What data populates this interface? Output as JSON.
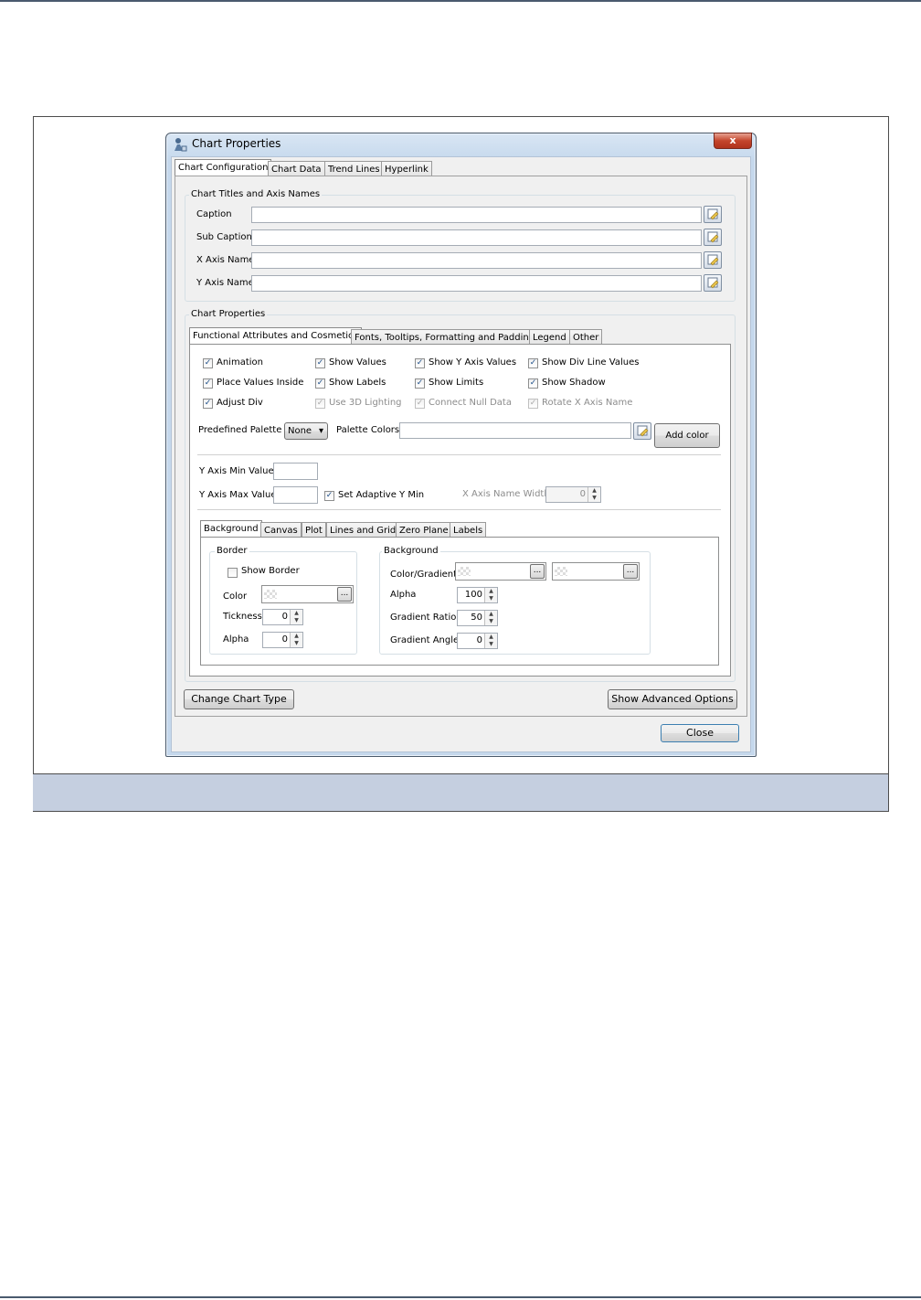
{
  "window": {
    "title": "Chart Properties",
    "close_glyph": "x",
    "icon": "app-icon"
  },
  "top_tabs": [
    "Chart Configuration",
    "Chart Data",
    "Trend Lines",
    "Hyperlink"
  ],
  "titles_group": {
    "title": "Chart Titles and Axis Names",
    "fields": [
      {
        "label": "Caption",
        "value": ""
      },
      {
        "label": "Sub Caption",
        "value": ""
      },
      {
        "label": "X Axis Name",
        "value": ""
      },
      {
        "label": "Y Axis Name",
        "value": ""
      }
    ]
  },
  "props_group": {
    "title": "Chart Properties"
  },
  "sub_tabs": [
    "Functional Attributes and Cosmetics",
    "Fonts, Tooltips, Formatting and Padding",
    "Legend",
    "Other"
  ],
  "checkboxes": {
    "animation": {
      "label": "Animation",
      "checked": true
    },
    "show_values": {
      "label": "Show Values",
      "checked": true
    },
    "show_y_axis_values": {
      "label": "Show Y Axis Values",
      "checked": true
    },
    "show_div_line_values": {
      "label": "Show Div Line Values",
      "checked": true
    },
    "place_values_inside": {
      "label": "Place Values Inside",
      "checked": true
    },
    "show_labels": {
      "label": "Show Labels",
      "checked": true
    },
    "show_limits": {
      "label": "Show Limits",
      "checked": true
    },
    "show_shadow": {
      "label": "Show Shadow",
      "checked": true
    },
    "adjust_div": {
      "label": "Adjust Div",
      "checked": true
    },
    "use_3d_lighting": {
      "label": "Use 3D Lighting",
      "checked": true
    },
    "connect_null_data": {
      "label": "Connect Null Data",
      "checked": true
    },
    "rotate_x_axis_name": {
      "label": "Rotate X Axis Name",
      "checked": true
    },
    "set_adaptive_y_min": {
      "label": "Set Adaptive Y Min",
      "checked": true
    }
  },
  "palette": {
    "label": "Predefined Palette",
    "selected": "None",
    "colors_label": "Palette Colors",
    "colors_value": "",
    "add_color": "Add color"
  },
  "axis": {
    "y_min_label": "Y Axis Min Value",
    "y_max_label": "Y Axis Max Value",
    "x_name_width_label": "X Axis Name Width",
    "x_name_width_value": "0",
    "y_min_value": "",
    "y_max_value": ""
  },
  "bg_tabs": [
    "Background",
    "Canvas",
    "Plot",
    "Lines and Grid",
    "Zero Plane",
    "Labels"
  ],
  "border": {
    "title": "Border",
    "show_border": "Show Border",
    "show_border_checked": false,
    "color_label": "Color",
    "thickness_label": "Tickness",
    "thickness_value": "0",
    "alpha_label": "Alpha",
    "alpha_value": "0"
  },
  "background": {
    "title": "Background",
    "color_label": "Color/Gradient",
    "alpha_label": "Alpha",
    "alpha_value": "100",
    "ratio_label": "Gradient Ratio",
    "ratio_value": "50",
    "angle_label": "Gradient Angle",
    "angle_value": "0"
  },
  "buttons": {
    "change_type": "Change Chart Type",
    "advanced": "Show Advanced Options",
    "close": "Close",
    "ellipsis": "..."
  },
  "spin_arrows": {
    "up": "▲",
    "down": "▼"
  },
  "check_mark": "✓",
  "dropdown_arrow": "▾"
}
